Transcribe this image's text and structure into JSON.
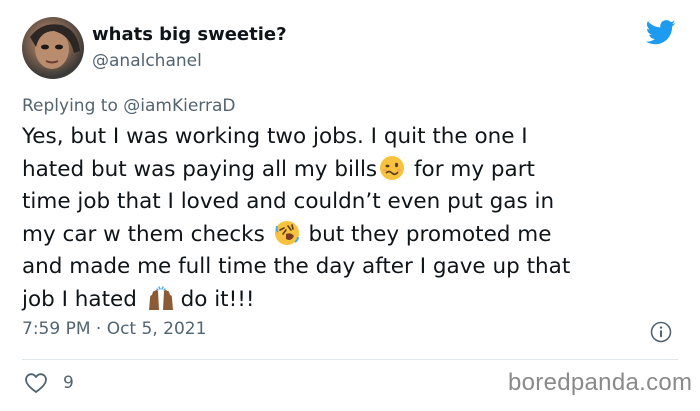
{
  "user": {
    "display_name": "whats big sweetie?",
    "handle": "@analchanel"
  },
  "reply": {
    "prefix": "Replying to",
    "mention": "@iamKierraD"
  },
  "tweet": {
    "lines": [
      "Yes, but I was working two jobs. I quit the one I",
      "hated but was paying all my bills",
      "for my part",
      "time job that I loved and couldn’t even put gas in",
      "my car w them checks",
      "but they promoted me",
      "and made me full time the day after I gave up that",
      "job I hated",
      "do it!!!"
    ],
    "emojis": [
      "woozy-face-emoji",
      "rolling-on-floor-laughing-emoji",
      "raising-hands-emoji"
    ]
  },
  "meta": {
    "timestamp": "7:59 PM · Oct 5, 2021"
  },
  "stats": {
    "likes": "9"
  },
  "watermark": "boredpanda.com",
  "icons": {
    "brand": "twitter-bird-icon",
    "info": "info-icon",
    "like": "heart-icon"
  },
  "colors": {
    "twitter_blue": "#1d9bf0",
    "secondary_text": "#536471",
    "primary_text": "#0f1419"
  }
}
